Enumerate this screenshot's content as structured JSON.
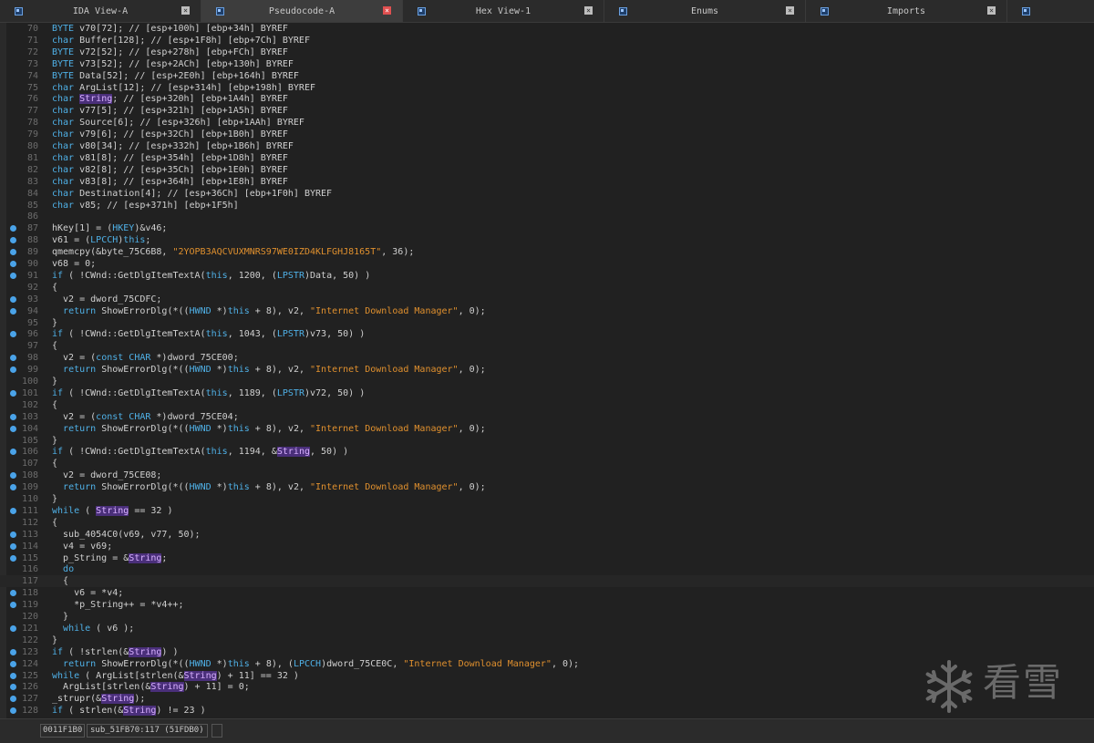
{
  "tabs": [
    {
      "label": "IDA View-A",
      "active": false,
      "close_glyph": "×"
    },
    {
      "label": "Pseudocode-A",
      "active": true,
      "close_glyph": "×"
    },
    {
      "label": "Hex View-1",
      "active": false,
      "close_glyph": "×"
    },
    {
      "label": "Enums",
      "active": false,
      "close_glyph": "×"
    },
    {
      "label": "Imports",
      "active": false,
      "close_glyph": "×"
    },
    {
      "label": "",
      "active": false,
      "close_glyph": ""
    }
  ],
  "lines": [
    {
      "n": "70",
      "bp": false,
      "segs": [
        [
          "kw",
          "BYTE"
        ],
        [
          "p",
          " v70[72]; // [esp+100h] [ebp+34h] BYREF"
        ]
      ]
    },
    {
      "n": "71",
      "bp": false,
      "segs": [
        [
          "kw",
          "char"
        ],
        [
          "p",
          " Buffer[128]; // [esp+1F8h] [ebp+7Ch] BYREF"
        ]
      ]
    },
    {
      "n": "72",
      "bp": false,
      "segs": [
        [
          "kw",
          "BYTE"
        ],
        [
          "p",
          " v72[52]; // [esp+278h] [ebp+FCh] BYREF"
        ]
      ]
    },
    {
      "n": "73",
      "bp": false,
      "segs": [
        [
          "kw",
          "BYTE"
        ],
        [
          "p",
          " v73[52]; // [esp+2ACh] [ebp+130h] BYREF"
        ]
      ]
    },
    {
      "n": "74",
      "bp": false,
      "segs": [
        [
          "kw",
          "BYTE"
        ],
        [
          "p",
          " Data[52]; // [esp+2E0h] [ebp+164h] BYREF"
        ]
      ]
    },
    {
      "n": "75",
      "bp": false,
      "segs": [
        [
          "kw",
          "char"
        ],
        [
          "p",
          " ArgList[12]; // [esp+314h] [ebp+198h] BYREF"
        ]
      ]
    },
    {
      "n": "76",
      "bp": false,
      "segs": [
        [
          "kw",
          "char"
        ],
        [
          "p",
          " "
        ],
        [
          "m",
          "String"
        ],
        [
          "p",
          "; // [esp+320h] [ebp+1A4h] BYREF"
        ]
      ]
    },
    {
      "n": "77",
      "bp": false,
      "segs": [
        [
          "kw",
          "char"
        ],
        [
          "p",
          " v77[5]; // [esp+321h] [ebp+1A5h] BYREF"
        ]
      ]
    },
    {
      "n": "78",
      "bp": false,
      "segs": [
        [
          "kw",
          "char"
        ],
        [
          "p",
          " Source[6]; // [esp+326h] [ebp+1AAh] BYREF"
        ]
      ]
    },
    {
      "n": "79",
      "bp": false,
      "segs": [
        [
          "kw",
          "char"
        ],
        [
          "p",
          " v79[6]; // [esp+32Ch] [ebp+1B0h] BYREF"
        ]
      ]
    },
    {
      "n": "80",
      "bp": false,
      "segs": [
        [
          "kw",
          "char"
        ],
        [
          "p",
          " v80[34]; // [esp+332h] [ebp+1B6h] BYREF"
        ]
      ]
    },
    {
      "n": "81",
      "bp": false,
      "segs": [
        [
          "kw",
          "char"
        ],
        [
          "p",
          " v81[8]; // [esp+354h] [ebp+1D8h] BYREF"
        ]
      ]
    },
    {
      "n": "82",
      "bp": false,
      "segs": [
        [
          "kw",
          "char"
        ],
        [
          "p",
          " v82[8]; // [esp+35Ch] [ebp+1E0h] BYREF"
        ]
      ]
    },
    {
      "n": "83",
      "bp": false,
      "segs": [
        [
          "kw",
          "char"
        ],
        [
          "p",
          " v83[8]; // [esp+364h] [ebp+1E8h] BYREF"
        ]
      ]
    },
    {
      "n": "84",
      "bp": false,
      "segs": [
        [
          "kw",
          "char"
        ],
        [
          "p",
          " Destination[4]; // [esp+36Ch] [ebp+1F0h] BYREF"
        ]
      ]
    },
    {
      "n": "85",
      "bp": false,
      "segs": [
        [
          "kw",
          "char"
        ],
        [
          "p",
          " v85; // [esp+371h] [ebp+1F5h]"
        ]
      ]
    },
    {
      "n": "86",
      "bp": false,
      "segs": [
        [
          "p",
          ""
        ]
      ]
    },
    {
      "n": "87",
      "bp": true,
      "segs": [
        [
          "p",
          "hKey[1] = ("
        ],
        [
          "kw",
          "HKEY"
        ],
        [
          "p",
          ")&v46;"
        ]
      ]
    },
    {
      "n": "88",
      "bp": true,
      "segs": [
        [
          "p",
          "v61 = ("
        ],
        [
          "kw",
          "LPCCH"
        ],
        [
          "p",
          ")"
        ],
        [
          "kw",
          "this"
        ],
        [
          "p",
          ";"
        ]
      ]
    },
    {
      "n": "89",
      "bp": true,
      "segs": [
        [
          "p",
          "qmemcpy(&byte_75C6B8, "
        ],
        [
          "s",
          "\"2YOPB3AQCVUXMNRS97WE0IZD4KLFGHJ8165T\""
        ],
        [
          "p",
          ", 36);"
        ]
      ]
    },
    {
      "n": "90",
      "bp": true,
      "segs": [
        [
          "p",
          "v68 = 0;"
        ]
      ]
    },
    {
      "n": "91",
      "bp": true,
      "segs": [
        [
          "kw",
          "if"
        ],
        [
          "p",
          " ( !CWnd::GetDlgItemTextA("
        ],
        [
          "kw",
          "this"
        ],
        [
          "p",
          ", 1200, ("
        ],
        [
          "kw",
          "LPSTR"
        ],
        [
          "p",
          ")Data, 50) )"
        ]
      ]
    },
    {
      "n": "92",
      "bp": false,
      "segs": [
        [
          "p",
          "{"
        ]
      ]
    },
    {
      "n": "93",
      "bp": true,
      "segs": [
        [
          "p",
          "  v2 = dword_75CDFC;"
        ]
      ]
    },
    {
      "n": "94",
      "bp": true,
      "segs": [
        [
          "p",
          "  "
        ],
        [
          "kw",
          "return"
        ],
        [
          "p",
          " ShowErrorDlg(*(("
        ],
        [
          "kw",
          "HWND"
        ],
        [
          "p",
          " *)"
        ],
        [
          "kw",
          "this"
        ],
        [
          "p",
          " + 8), v2, "
        ],
        [
          "s",
          "\"Internet Download Manager\""
        ],
        [
          "p",
          ", 0);"
        ]
      ]
    },
    {
      "n": "95",
      "bp": false,
      "segs": [
        [
          "p",
          "}"
        ]
      ]
    },
    {
      "n": "96",
      "bp": true,
      "segs": [
        [
          "kw",
          "if"
        ],
        [
          "p",
          " ( !CWnd::GetDlgItemTextA("
        ],
        [
          "kw",
          "this"
        ],
        [
          "p",
          ", 1043, ("
        ],
        [
          "kw",
          "LPSTR"
        ],
        [
          "p",
          ")v73, 50) )"
        ]
      ]
    },
    {
      "n": "97",
      "bp": false,
      "segs": [
        [
          "p",
          "{"
        ]
      ]
    },
    {
      "n": "98",
      "bp": true,
      "segs": [
        [
          "p",
          "  v2 = ("
        ],
        [
          "kw",
          "const CHAR"
        ],
        [
          "p",
          " *)dword_75CE00;"
        ]
      ]
    },
    {
      "n": "99",
      "bp": true,
      "segs": [
        [
          "p",
          "  "
        ],
        [
          "kw",
          "return"
        ],
        [
          "p",
          " ShowErrorDlg(*(("
        ],
        [
          "kw",
          "HWND"
        ],
        [
          "p",
          " *)"
        ],
        [
          "kw",
          "this"
        ],
        [
          "p",
          " + 8), v2, "
        ],
        [
          "s",
          "\"Internet Download Manager\""
        ],
        [
          "p",
          ", 0);"
        ]
      ]
    },
    {
      "n": "100",
      "bp": false,
      "segs": [
        [
          "p",
          "}"
        ]
      ]
    },
    {
      "n": "101",
      "bp": true,
      "segs": [
        [
          "kw",
          "if"
        ],
        [
          "p",
          " ( !CWnd::GetDlgItemTextA("
        ],
        [
          "kw",
          "this"
        ],
        [
          "p",
          ", 1189, ("
        ],
        [
          "kw",
          "LPSTR"
        ],
        [
          "p",
          ")v72, 50) )"
        ]
      ]
    },
    {
      "n": "102",
      "bp": false,
      "segs": [
        [
          "p",
          "{"
        ]
      ]
    },
    {
      "n": "103",
      "bp": true,
      "segs": [
        [
          "p",
          "  v2 = ("
        ],
        [
          "kw",
          "const CHAR"
        ],
        [
          "p",
          " *)dword_75CE04;"
        ]
      ]
    },
    {
      "n": "104",
      "bp": true,
      "segs": [
        [
          "p",
          "  "
        ],
        [
          "kw",
          "return"
        ],
        [
          "p",
          " ShowErrorDlg(*(("
        ],
        [
          "kw",
          "HWND"
        ],
        [
          "p",
          " *)"
        ],
        [
          "kw",
          "this"
        ],
        [
          "p",
          " + 8), v2, "
        ],
        [
          "s",
          "\"Internet Download Manager\""
        ],
        [
          "p",
          ", 0);"
        ]
      ]
    },
    {
      "n": "105",
      "bp": false,
      "segs": [
        [
          "p",
          "}"
        ]
      ]
    },
    {
      "n": "106",
      "bp": true,
      "segs": [
        [
          "kw",
          "if"
        ],
        [
          "p",
          " ( !CWnd::GetDlgItemTextA("
        ],
        [
          "kw",
          "this"
        ],
        [
          "p",
          ", 1194, &"
        ],
        [
          "m",
          "String"
        ],
        [
          "p",
          ", 50) )"
        ]
      ]
    },
    {
      "n": "107",
      "bp": false,
      "segs": [
        [
          "p",
          "{"
        ]
      ]
    },
    {
      "n": "108",
      "bp": true,
      "segs": [
        [
          "p",
          "  v2 = dword_75CE08;"
        ]
      ]
    },
    {
      "n": "109",
      "bp": true,
      "segs": [
        [
          "p",
          "  "
        ],
        [
          "kw",
          "return"
        ],
        [
          "p",
          " ShowErrorDlg(*(("
        ],
        [
          "kw",
          "HWND"
        ],
        [
          "p",
          " *)"
        ],
        [
          "kw",
          "this"
        ],
        [
          "p",
          " + 8), v2, "
        ],
        [
          "s",
          "\"Internet Download Manager\""
        ],
        [
          "p",
          ", 0);"
        ]
      ]
    },
    {
      "n": "110",
      "bp": false,
      "segs": [
        [
          "p",
          "}"
        ]
      ]
    },
    {
      "n": "111",
      "bp": true,
      "segs": [
        [
          "kw",
          "while"
        ],
        [
          "p",
          " ( "
        ],
        [
          "m",
          "String"
        ],
        [
          "p",
          " == 32 )"
        ]
      ]
    },
    {
      "n": "112",
      "bp": false,
      "segs": [
        [
          "p",
          "{"
        ]
      ]
    },
    {
      "n": "113",
      "bp": true,
      "segs": [
        [
          "p",
          "  sub_4054C0(v69, v77, 50);"
        ]
      ]
    },
    {
      "n": "114",
      "bp": true,
      "segs": [
        [
          "p",
          "  v4 = v69;"
        ]
      ]
    },
    {
      "n": "115",
      "bp": true,
      "segs": [
        [
          "p",
          "  p_String = &"
        ],
        [
          "m",
          "String"
        ],
        [
          "p",
          ";"
        ]
      ]
    },
    {
      "n": "116",
      "bp": false,
      "segs": [
        [
          "p",
          "  "
        ],
        [
          "kw",
          "do"
        ]
      ]
    },
    {
      "n": "117",
      "bp": false,
      "hl": true,
      "segs": [
        [
          "p",
          "  {"
        ]
      ]
    },
    {
      "n": "118",
      "bp": true,
      "segs": [
        [
          "p",
          "    v6 = *v4;"
        ]
      ]
    },
    {
      "n": "119",
      "bp": true,
      "segs": [
        [
          "p",
          "    *p_String++ = *v4++;"
        ]
      ]
    },
    {
      "n": "120",
      "bp": false,
      "segs": [
        [
          "p",
          "  }"
        ]
      ]
    },
    {
      "n": "121",
      "bp": true,
      "segs": [
        [
          "p",
          "  "
        ],
        [
          "kw",
          "while"
        ],
        [
          "p",
          " ( v6 );"
        ]
      ]
    },
    {
      "n": "122",
      "bp": false,
      "segs": [
        [
          "p",
          "}"
        ]
      ]
    },
    {
      "n": "123",
      "bp": true,
      "segs": [
        [
          "kw",
          "if"
        ],
        [
          "p",
          " ( !strlen(&"
        ],
        [
          "m",
          "String"
        ],
        [
          "p",
          ") )"
        ]
      ]
    },
    {
      "n": "124",
      "bp": true,
      "segs": [
        [
          "p",
          "  "
        ],
        [
          "kw",
          "return"
        ],
        [
          "p",
          " ShowErrorDlg(*(("
        ],
        [
          "kw",
          "HWND"
        ],
        [
          "p",
          " *)"
        ],
        [
          "kw",
          "this"
        ],
        [
          "p",
          " + 8), ("
        ],
        [
          "kw",
          "LPCCH"
        ],
        [
          "p",
          ")dword_75CE0C, "
        ],
        [
          "s",
          "\"Internet Download Manager\""
        ],
        [
          "p",
          ", 0);"
        ]
      ]
    },
    {
      "n": "125",
      "bp": true,
      "segs": [
        [
          "kw",
          "while"
        ],
        [
          "p",
          " ( ArgList[strlen(&"
        ],
        [
          "m",
          "String"
        ],
        [
          "p",
          ") + 11] == 32 )"
        ]
      ]
    },
    {
      "n": "126",
      "bp": true,
      "segs": [
        [
          "p",
          "  ArgList[strlen(&"
        ],
        [
          "m",
          "String"
        ],
        [
          "p",
          ") + 11] = 0;"
        ]
      ]
    },
    {
      "n": "127",
      "bp": true,
      "segs": [
        [
          "p",
          "_strupr(&"
        ],
        [
          "m",
          "String"
        ],
        [
          "p",
          ");"
        ]
      ]
    },
    {
      "n": "128",
      "bp": true,
      "segs": [
        [
          "kw",
          "if"
        ],
        [
          "p",
          " ( strlen(&"
        ],
        [
          "m",
          "String"
        ],
        [
          "p",
          ") != 23 )"
        ]
      ]
    }
  ],
  "status": {
    "address": "0011F1B0",
    "function": "sub_51FB70:117 (51FDB0)"
  },
  "watermark": {
    "text": "看雪",
    "icon": "snowflake-icon"
  },
  "colors": {
    "keyword": "#4fb0e6",
    "string": "#e0902e",
    "highlight": "#4a2f7a",
    "breakpoint": "#4aa3e8"
  }
}
